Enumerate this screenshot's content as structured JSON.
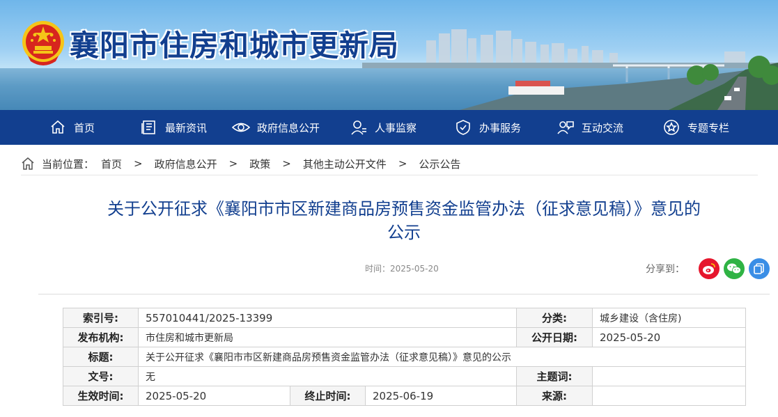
{
  "site": {
    "title": "襄阳市住房和城市更新局"
  },
  "nav": [
    {
      "label": "首页",
      "icon": "home-icon"
    },
    {
      "label": "最新资讯",
      "icon": "news-icon"
    },
    {
      "label": "政府信息公开",
      "icon": "eye-icon"
    },
    {
      "label": "人事监察",
      "icon": "person-icon"
    },
    {
      "label": "办事服务",
      "icon": "shield-icon"
    },
    {
      "label": "互动交流",
      "icon": "chat-people-icon"
    },
    {
      "label": "专题专栏",
      "icon": "star-icon"
    }
  ],
  "breadcrumb": {
    "prefix": "当前位置：",
    "separator": ">",
    "items": [
      "首页",
      "政府信息公开",
      "政策",
      "其他主动公开文件",
      "公示公告"
    ]
  },
  "article": {
    "title_line1": "关于公开征求《襄阳市市区新建商品房预售资金监管办法（征求意见稿）》意见的",
    "title_line2": "公示",
    "time_label": "时间：",
    "time_value": "2025-05-20",
    "share_label": "分享到："
  },
  "meta": {
    "index_label": "索引号:",
    "index_value": "557010441/2025-13399",
    "category_label": "分类:",
    "category_value": "城乡建设（含住房)",
    "publisher_label": "发布机构:",
    "publisher_value": "市住房和城市更新局",
    "pubdate_label": "公开日期:",
    "pubdate_value": "2025-05-20",
    "title_label": "标题:",
    "title_value": "关于公开征求《襄阳市市区新建商品房预售资金监管办法（征求意见稿）》意见的公示",
    "docno_label": "文号:",
    "docno_value": "无",
    "subject_label": "主题词:",
    "subject_value": "",
    "effective_label": "生效时间:",
    "effective_value": "2025-05-20",
    "end_label": "终止时间:",
    "end_value": "2025-06-19",
    "source_label": "来源:",
    "source_value": ""
  },
  "colors": {
    "nav_bg": "#123f8f",
    "title_blue": "#123f8f",
    "weibo": "#e6162d",
    "wechat": "#2fb344",
    "qzone": "#3a8ee6"
  }
}
